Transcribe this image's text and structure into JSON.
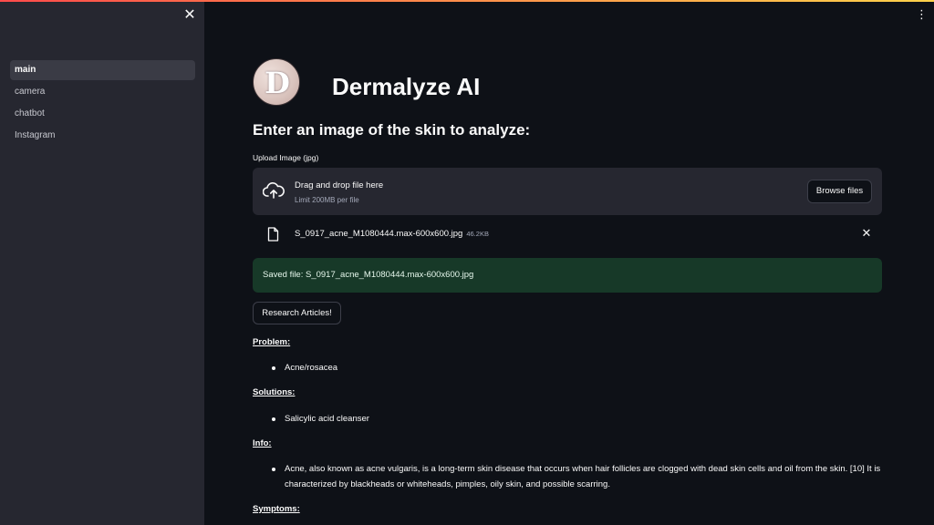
{
  "sidebar": {
    "close_icon": "close-icon",
    "items": [
      {
        "label": "main",
        "active": true
      },
      {
        "label": "camera",
        "active": false
      },
      {
        "label": "chatbot",
        "active": false
      },
      {
        "label": "Instagram",
        "active": false
      }
    ]
  },
  "header": {
    "menu_icon": "vertical-dots-icon",
    "logo_letter": "D",
    "title": "Dermalyze AI"
  },
  "main": {
    "subtitle": "Enter an image of the skin to analyze:",
    "uploader": {
      "label": "Upload Image (jpg)",
      "drop_text": "Drag and drop file here",
      "limit_text": "Limit 200MB per file",
      "browse_label": "Browse files"
    },
    "file": {
      "name": "S_0917_acne_M1080444.max-600x600.jpg",
      "size": "46.2KB"
    },
    "saved_message": "Saved file: S_0917_acne_M1080444.max-600x600.jpg",
    "research_label": "Research Articles!",
    "sections": {
      "problem_heading": "Problem:",
      "problem_item": "Acne/rosacea",
      "solutions_heading": "Solutions:",
      "solutions_item": "Salicylic acid cleanser",
      "info_heading": "Info:",
      "info_item": "Acne, also known as acne vulgaris, is a long-term skin disease that occurs when hair follicles are clogged with dead skin cells and oil from the skin. [10] It is characterized by blackheads or whiteheads, pimples, oily skin, and possible scarring.",
      "symptoms_heading": "Symptoms:"
    }
  },
  "colors": {
    "background": "#0e1117",
    "sidebar": "#262730",
    "success_bg": "#173928",
    "accent_gradient_start": "#ff4b4b",
    "accent_gradient_end": "#ffd24b"
  }
}
